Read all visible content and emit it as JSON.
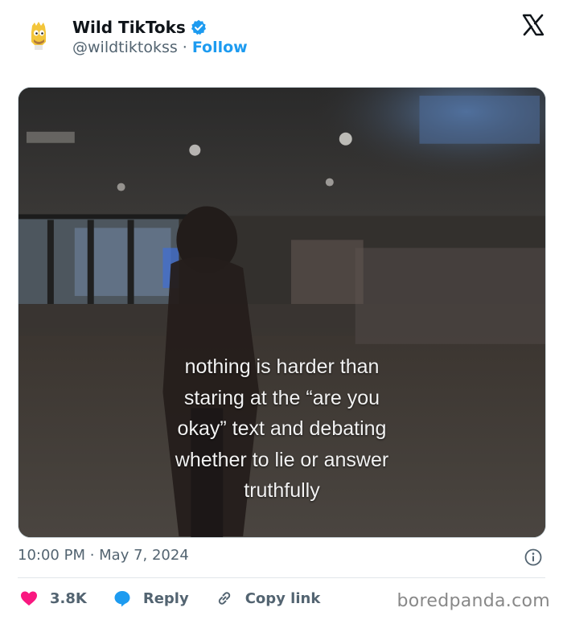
{
  "tweet": {
    "author_name": "Wild TikToks",
    "handle": "@wildtiktokss",
    "separator": "·",
    "follow_label": "Follow",
    "timestamp": "10:00 PM · May 7, 2024",
    "media_caption": [
      "nothing is harder than",
      "staring at the “are you",
      "okay” text and debating",
      "whether to lie or answer",
      "truthfully"
    ]
  },
  "actions": {
    "likes": "3.8K",
    "reply_label": "Reply",
    "copy_link_label": "Copy link"
  },
  "watermark": "boredpanda.com",
  "colors": {
    "accent": "#1d9bf0",
    "like": "#f91880",
    "secondary_text": "#536471"
  },
  "icons": [
    "x-logo-icon",
    "verified-badge-icon",
    "info-icon",
    "heart-icon",
    "reply-bubble-icon",
    "link-icon"
  ]
}
